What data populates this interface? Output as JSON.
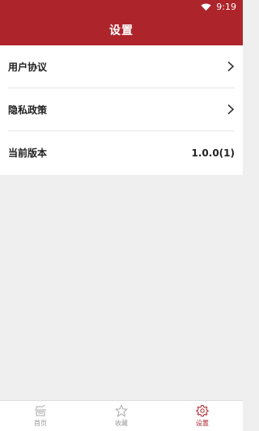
{
  "status_bar": {
    "time": "9:19"
  },
  "header": {
    "title": "设置"
  },
  "settings": {
    "items": [
      {
        "label": "用户协议"
      },
      {
        "label": "隐私政策"
      },
      {
        "label": "当前版本",
        "value": "1.0.0(1)"
      }
    ]
  },
  "tab_bar": {
    "tabs": [
      {
        "label": "首页",
        "icon": "home-icon"
      },
      {
        "label": "收藏",
        "icon": "star-icon"
      },
      {
        "label": "设置",
        "icon": "gear-icon",
        "active": true
      }
    ]
  },
  "colors": {
    "brand": "#ad242b"
  }
}
